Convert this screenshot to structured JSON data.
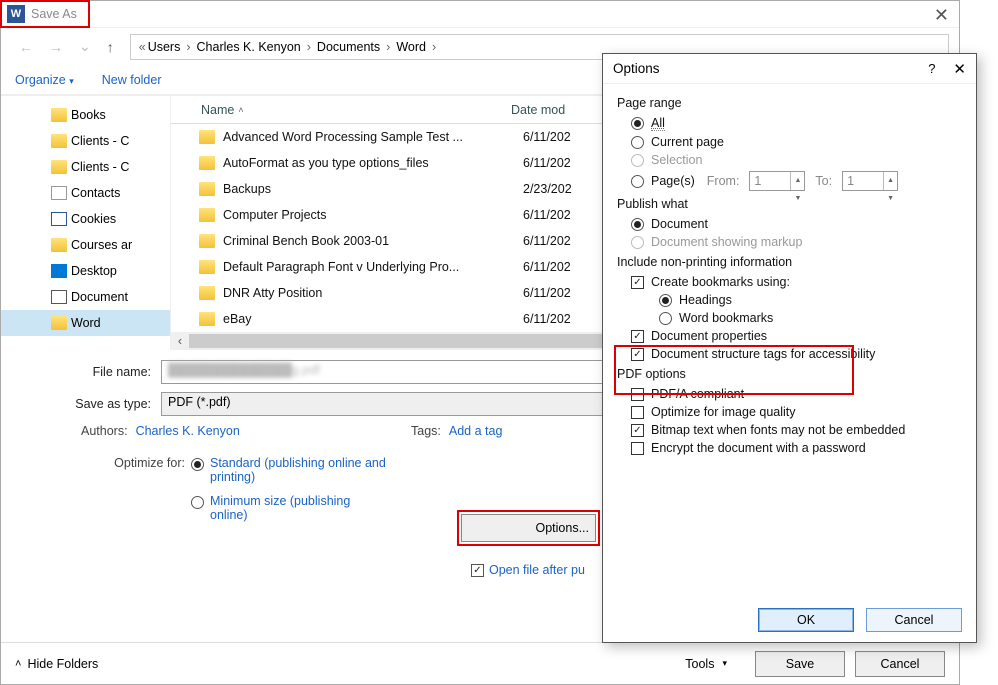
{
  "titlebar": {
    "title": "Save As"
  },
  "breadcrumb": [
    "Users",
    "Charles K. Kenyon",
    "Documents",
    "Word"
  ],
  "toolbar": {
    "organize": "Organize",
    "newfolder": "New folder"
  },
  "sidebar": {
    "items": [
      {
        "label": "Books",
        "icon": "folder"
      },
      {
        "label": "Clients - C",
        "icon": "folder"
      },
      {
        "label": "Clients - C",
        "icon": "folder"
      },
      {
        "label": "Contacts",
        "icon": "contact"
      },
      {
        "label": "Cookies",
        "icon": "cookie"
      },
      {
        "label": "Courses ar",
        "icon": "folder"
      },
      {
        "label": "Desktop",
        "icon": "desktop"
      },
      {
        "label": "Document",
        "icon": "doc"
      },
      {
        "label": "Word",
        "icon": "folder",
        "selected": true
      }
    ]
  },
  "filelist": {
    "columns": {
      "name": "Name",
      "date": "Date mod"
    },
    "rows": [
      {
        "name": "Advanced Word Processing Sample Test ...",
        "date": "6/11/202"
      },
      {
        "name": "AutoFormat as you type options_files",
        "date": "6/11/202"
      },
      {
        "name": "Backups",
        "date": "2/23/202"
      },
      {
        "name": "Computer Projects",
        "date": "6/11/202"
      },
      {
        "name": "Criminal Bench Book 2003-01",
        "date": "6/11/202"
      },
      {
        "name": "Default Paragraph Font v Underlying Pro...",
        "date": "6/11/202"
      },
      {
        "name": "DNR Atty Position",
        "date": "6/11/202"
      },
      {
        "name": "eBay",
        "date": "6/11/202"
      }
    ]
  },
  "form": {
    "filename_label": "File name:",
    "filename_value": "██████████████g.pdf",
    "saveastype_label": "Save as type:",
    "saveastype_value": "PDF (*.pdf)",
    "authors_label": "Authors:",
    "authors_value": "Charles K. Kenyon",
    "tags_label": "Tags:",
    "tags_value": "Add a tag",
    "optimize_label": "Optimize for:",
    "optimize_standard": "Standard (publishing online and printing)",
    "optimize_minimum": "Minimum size (publishing online)",
    "options_button": "Options...",
    "open_after": "Open file after pu"
  },
  "footer": {
    "hide_folders": "Hide Folders",
    "tools": "Tools",
    "save": "Save",
    "cancel": "Cancel"
  },
  "options_dialog": {
    "title": "Options",
    "help": "?",
    "page_range": {
      "label": "Page range",
      "all": "All",
      "current": "Current page",
      "selection": "Selection",
      "pages": "Page(s)",
      "from": "From:",
      "from_val": "1",
      "to": "To:",
      "to_val": "1"
    },
    "publish": {
      "label": "Publish what",
      "document": "Document",
      "markup": "Document showing markup"
    },
    "nonprint": {
      "label": "Include non-printing information",
      "create_bookmarks": "Create bookmarks using:",
      "headings": "Headings",
      "word_bookmarks": "Word bookmarks",
      "doc_props": "Document properties",
      "structure_tags": "Document structure tags for accessibility"
    },
    "pdf_opts": {
      "label": "PDF options",
      "pdfa": "PDF/A compliant",
      "image_quality": "Optimize for image quality",
      "bitmap_text": "Bitmap text when fonts may not be embedded",
      "encrypt": "Encrypt the document with a password"
    },
    "ok": "OK",
    "cancel": "Cancel"
  }
}
